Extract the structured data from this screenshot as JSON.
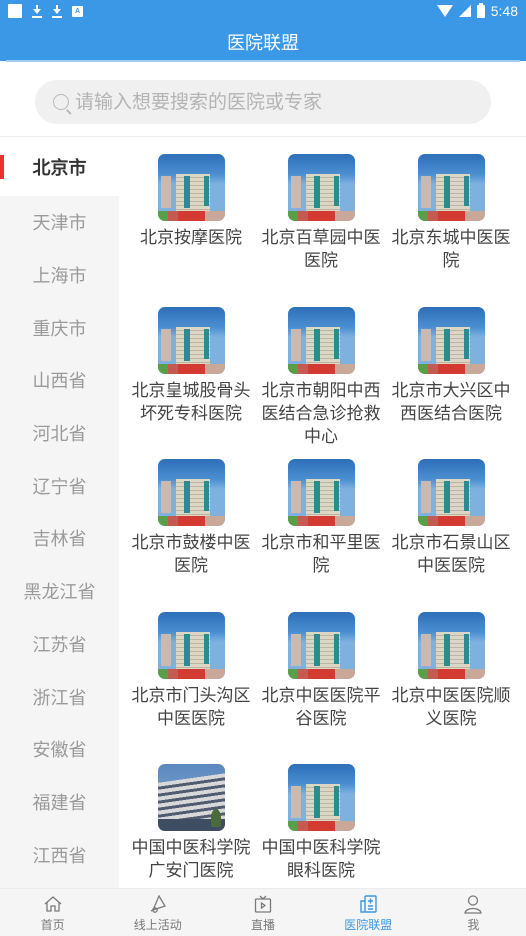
{
  "status_bar": {
    "time": "5:48",
    "notification_icons": [
      "square-icon",
      "download-icon",
      "download-icon",
      "a-icon"
    ]
  },
  "header": {
    "title": "医院联盟"
  },
  "search": {
    "placeholder": "请输入想要搜索的医院或专家",
    "value": ""
  },
  "sidebar": {
    "selected": "北京市",
    "items": [
      {
        "label": "北京市",
        "active": true
      },
      {
        "label": "天津市"
      },
      {
        "label": "上海市"
      },
      {
        "label": "重庆市"
      },
      {
        "label": "山西省"
      },
      {
        "label": "河北省"
      },
      {
        "label": "辽宁省"
      },
      {
        "label": "吉林省"
      },
      {
        "label": "黑龙江省"
      },
      {
        "label": "江苏省"
      },
      {
        "label": "浙江省"
      },
      {
        "label": "安徽省"
      },
      {
        "label": "福建省"
      },
      {
        "label": "江西省"
      }
    ]
  },
  "hospitals": [
    {
      "name": "北京按摩医院",
      "image": "hospital-building"
    },
    {
      "name": "北京百草园中医医院",
      "image": "hospital-building"
    },
    {
      "name": "北京东城中医医院",
      "image": "hospital-building"
    },
    {
      "name": "北京皇城股骨头坏死专科医院",
      "image": "hospital-building"
    },
    {
      "name": "北京市朝阳中西医结合急诊抢救中心",
      "image": "hospital-building"
    },
    {
      "name": "北京市大兴区中西医结合医院",
      "image": "hospital-building"
    },
    {
      "name": "北京市鼓楼中医医院",
      "image": "hospital-building"
    },
    {
      "name": "北京市和平里医院",
      "image": "hospital-building"
    },
    {
      "name": "北京市石景山区中医医院",
      "image": "hospital-building"
    },
    {
      "name": "北京市门头沟区中医医院",
      "image": "hospital-building"
    },
    {
      "name": "北京中医医院平谷医院",
      "image": "hospital-building"
    },
    {
      "name": "北京中医医院顺义医院",
      "image": "hospital-building"
    },
    {
      "name": "中国中医科学院广安门医院",
      "image": "guanganmen-building"
    },
    {
      "name": "中国中医科学院眼科医院",
      "image": "hospital-building"
    }
  ],
  "tabbar": {
    "items": [
      {
        "label": "首页",
        "icon": "home-icon"
      },
      {
        "label": "线上活动",
        "icon": "megaphone-icon"
      },
      {
        "label": "直播",
        "icon": "tv-play-icon"
      },
      {
        "label": "医院联盟",
        "icon": "hospital-card-icon",
        "active": true
      },
      {
        "label": "我",
        "icon": "user-icon"
      }
    ],
    "active_color": "#3a98e6",
    "inactive_color": "#7a7a7a"
  },
  "colors": {
    "brand": "#3a98e6",
    "selected_indicator": "#e8322f"
  }
}
